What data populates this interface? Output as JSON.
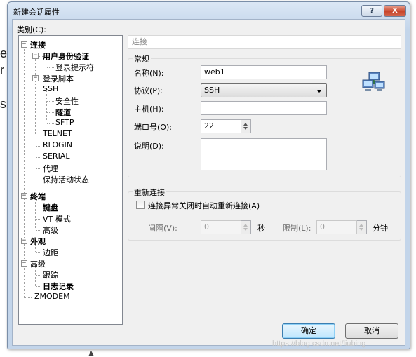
{
  "background": {
    "fragments": [
      "e",
      "r",
      "s"
    ]
  },
  "window": {
    "title": "新建会话属性",
    "help_btn": "?",
    "close_btn": "X"
  },
  "category_label": "类别(C):",
  "tree": {
    "connection": "连接",
    "user_auth": "用户身份验证",
    "login_prompt": "登录提示符",
    "login_script": "登录脚本",
    "ssh": "SSH",
    "security": "安全性",
    "tunnel": "隧道",
    "sftp": "SFTP",
    "telnet": "TELNET",
    "rlogin": "RLOGIN",
    "serial": "SERIAL",
    "proxy": "代理",
    "keepalive": "保持活动状态",
    "terminal": "终端",
    "keyboard": "键盘",
    "vt_mode": "VT 模式",
    "terminal_advanced": "高级",
    "appearance": "外观",
    "margin": "边距",
    "advanced": "高级",
    "trace": "跟踪",
    "logging": "日志记录",
    "zmodem": "ZMODEM"
  },
  "panel": {
    "header": "连接",
    "general": {
      "title": "常规",
      "name_label": "名称(N):",
      "name_value": "web1",
      "protocol_label": "协议(P):",
      "protocol_value": "SSH",
      "host_label": "主机(H):",
      "host_value": "",
      "port_label": "端口号(O):",
      "port_value": "22",
      "desc_label": "说明(D):",
      "desc_value": ""
    },
    "reconnect": {
      "title": "重新连接",
      "checkbox_label": "连接异常关闭时自动重新连接(A)",
      "interval_label": "间隔(V):",
      "interval_value": "0",
      "interval_unit": "秒",
      "limit_label": "限制(L):",
      "limit_value": "0",
      "limit_unit": "分钟"
    }
  },
  "buttons": {
    "ok": "确定",
    "cancel": "取消"
  },
  "watermark": "https://blog.csdn.net/liubing",
  "colors": {
    "title_gradient": "#c3d5ea",
    "close_button": "#c8452b",
    "ok_button": "#bee6fd"
  },
  "icons": {
    "network": "network-computers-icon"
  }
}
